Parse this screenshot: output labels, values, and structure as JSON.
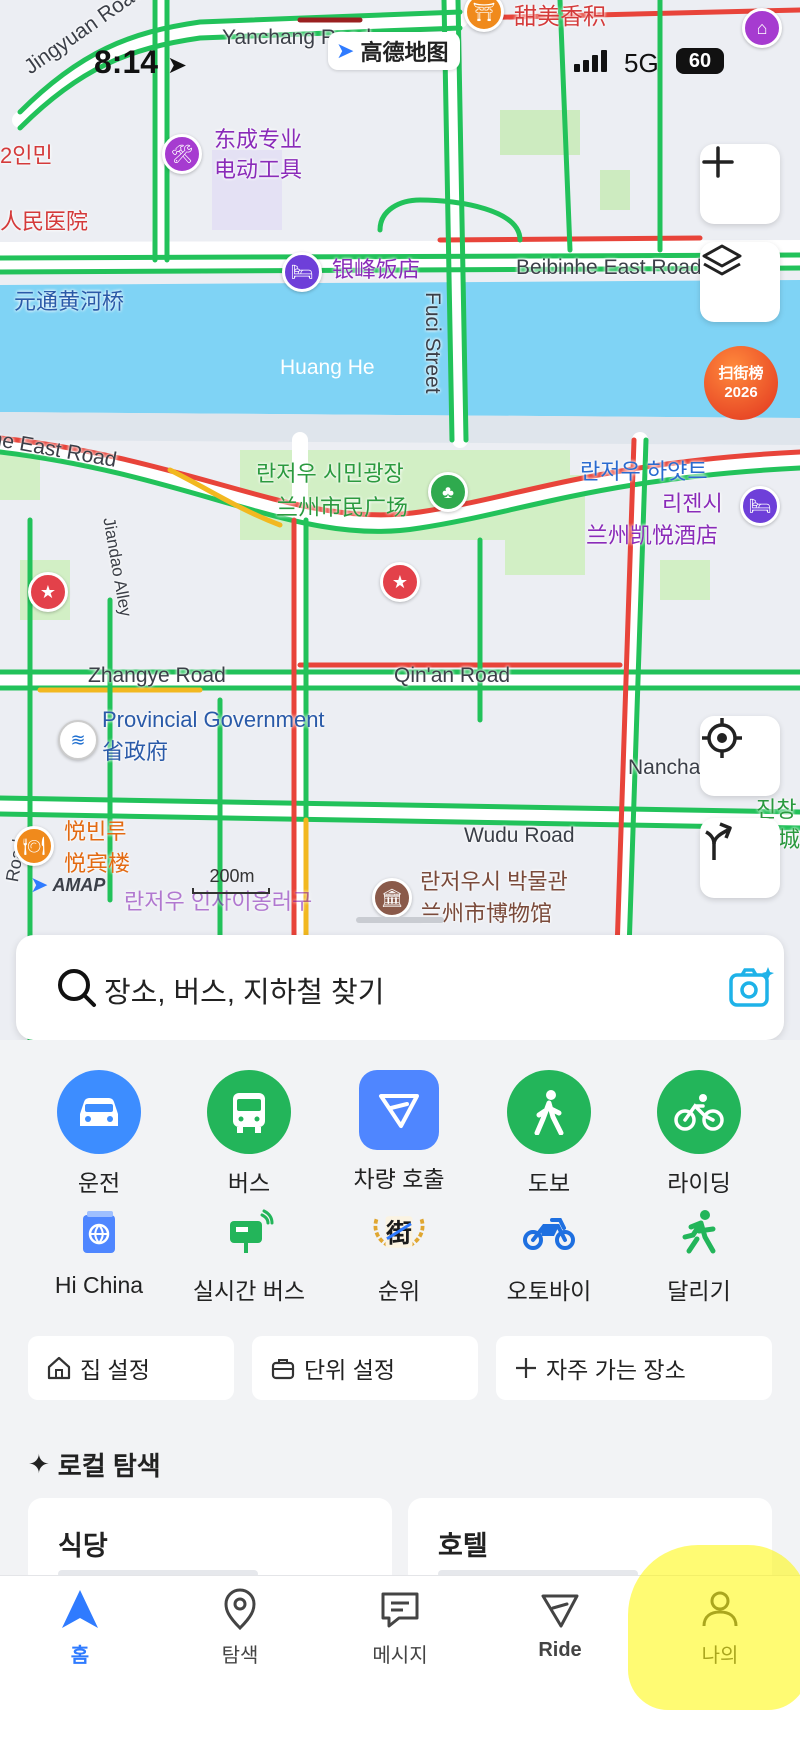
{
  "status": {
    "time": "8:14",
    "network": "5G",
    "battery": "60",
    "app_badge": "高德地图"
  },
  "map": {
    "roads": {
      "yanchang": "Yanchang Road",
      "jingyuan": "Jingyuan Road",
      "beibinhe": "Beibinhe East Road",
      "fuci": "Fuci Street",
      "huanghe": "Huang He",
      "east_road": "ne East Road",
      "jiandao": "Jiandao Alley",
      "zhangye": "Zhangye Road",
      "qinan": "Qin'an Road",
      "nancha": "Nancha",
      "wudu": "Wudu Road",
      "road_left": "Road"
    },
    "pois": {
      "tianmei": "甜美香积",
      "dongcheng_1": "东成专业",
      "dongcheng_2": "电动工具",
      "renmin_kr": "2인민",
      "renmin_cn": "人民医院",
      "yinfeng": "银峰饭店",
      "yuantong": "元通黄河桥",
      "plaza_kr": "란저우 시민광장",
      "plaza_cn": "兰州市民广场",
      "hyatt_kr_1": "란저우 하얏트",
      "hyatt_kr_2": "리젠시",
      "hyatt_cn": "兰州凯悦酒店",
      "provgov_en": "Provincial Government",
      "provgov_cn": "省政府",
      "yuebin_kr": "悦빈루",
      "yuebin_cn": "悦宾楼",
      "museum_kr": "란저우시 박물관",
      "museum_cn": "兰州市博物馆",
      "right_edge_1": "진창",
      "right_edge_2": "金城",
      "bottom_partial": "란저우 인사이옹러구"
    },
    "event_badge": [
      "扫街榜",
      "2026"
    ],
    "amap_logo": "AMAP",
    "scale": "200m"
  },
  "search": {
    "placeholder": "장소, 버스, 지하철 찾기"
  },
  "modes": [
    {
      "label": "운전",
      "icon": "car-icon",
      "color": "#3d8dff"
    },
    {
      "label": "버스",
      "icon": "bus-icon",
      "color": "#23b55a"
    },
    {
      "label": "차량 호출",
      "icon": "ride-hailing-icon",
      "color": "#4f86ff"
    },
    {
      "label": "도보",
      "icon": "walk-icon",
      "color": "#23b55a"
    },
    {
      "label": "라이딩",
      "icon": "bike-icon",
      "color": "#23b55a"
    }
  ],
  "services": [
    {
      "label": "Hi China",
      "icon": "passport-globe-icon"
    },
    {
      "label": "실시간 버스",
      "icon": "realtime-bus-icon"
    },
    {
      "label": "순위",
      "icon": "ranking-laurel-icon"
    },
    {
      "label": "오토바이",
      "icon": "motorcycle-icon"
    },
    {
      "label": "달리기",
      "icon": "running-icon"
    }
  ],
  "quick": {
    "home": "집 설정",
    "work": "단위 설정",
    "frequent": "자주 가는 장소"
  },
  "local": {
    "title": "로컬 탐색",
    "cards": [
      "식당",
      "호텔"
    ]
  },
  "tabs": [
    {
      "label": "홈",
      "icon": "navigation-arrow-icon"
    },
    {
      "label": "탐색",
      "icon": "location-pin-icon"
    },
    {
      "label": "메시지",
      "icon": "message-icon"
    },
    {
      "label": "Ride",
      "icon": "ride-icon"
    },
    {
      "label": "나의",
      "icon": "person-icon"
    }
  ],
  "colors": {
    "accent": "#2f7bff",
    "traffic_green": "#22c25a",
    "traffic_red": "#e8443a",
    "river": "#7fd3f5"
  }
}
